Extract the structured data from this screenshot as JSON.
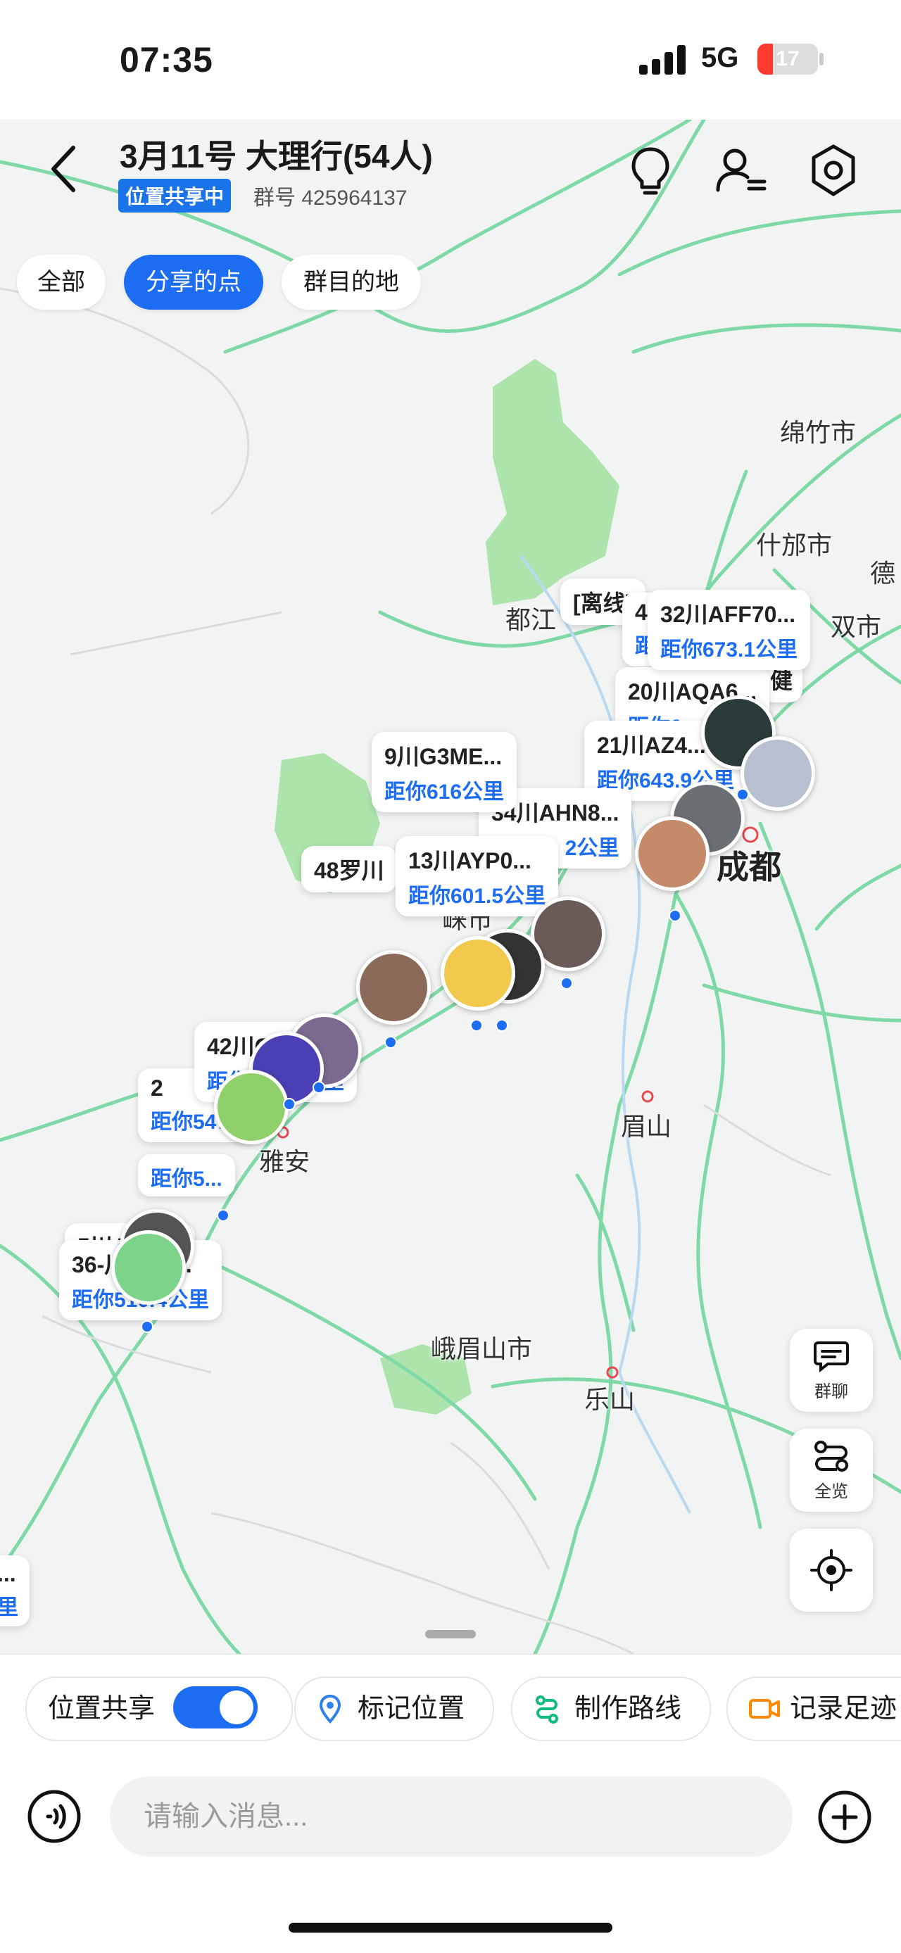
{
  "status_bar": {
    "time": "07:35",
    "network": "5G",
    "battery": "17"
  },
  "header": {
    "title": "3月11号 大理行(54人)",
    "share_badge": "位置共享中",
    "group_number": "群号 425964137"
  },
  "filters": [
    {
      "label": "全部",
      "active": false
    },
    {
      "label": "分享的点",
      "active": true
    },
    {
      "label": "群目的地",
      "active": false
    }
  ],
  "map": {
    "cities": [
      "绵竹市",
      "什邡市",
      "德",
      "都江",
      "双市",
      "成都",
      "眉山",
      "雅安",
      "峨眉山市",
      "乐山",
      "崃市"
    ],
    "pins": [
      {
        "name": "[离线]",
        "distance": ""
      },
      {
        "name": "4",
        "distance": "距"
      },
      {
        "name": "32川AFF70...",
        "distance": "距你673.1公里"
      },
      {
        "name": "20川AQA6...",
        "distance": "距你6..."
      },
      {
        "name": "21川AZ4...",
        "distance": "距你643.9公里"
      },
      {
        "name": "9川G3ME...",
        "distance": "距你616公里"
      },
      {
        "name": "34川AHN8...",
        "distance": "2公里"
      },
      {
        "name": "13川AYP0...",
        "distance": "距你601.5公里"
      },
      {
        "name": "48罗川",
        "distance": ""
      },
      {
        "name": "42川GG93...",
        "distance": "距你565.4公里"
      },
      {
        "name": "2",
        "distance": "距你547..."
      },
      {
        "name": "5川A388H",
        "distance": "距你5..."
      },
      {
        "name": "36-川G8B...",
        "distance": "距你510.4公里"
      },
      {
        "name": "...",
        "distance": "里"
      }
    ],
    "extra_label": "健"
  },
  "side_buttons": {
    "group_chat": "群聊",
    "overview": "全览"
  },
  "bottom": {
    "location_share": "位置共享",
    "location_share_on": true,
    "mark_location": "标记位置",
    "make_route": "制作路线",
    "record_footprint": "记录足迹",
    "message_placeholder": "请输入消息..."
  }
}
